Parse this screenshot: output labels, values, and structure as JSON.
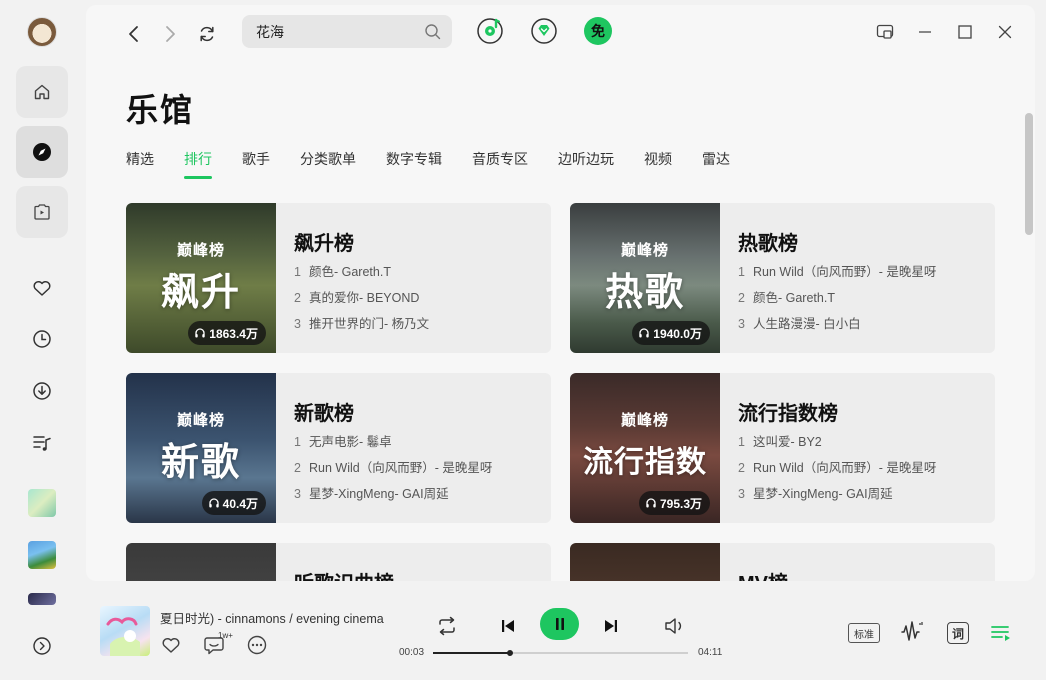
{
  "search": {
    "value": "花海"
  },
  "page": {
    "title": "乐馆"
  },
  "tabs": [
    {
      "label": "精选"
    },
    {
      "label": "排行"
    },
    {
      "label": "歌手"
    },
    {
      "label": "分类歌单"
    },
    {
      "label": "数字专辑"
    },
    {
      "label": "音质专区"
    },
    {
      "label": "边听边玩"
    },
    {
      "label": "视频"
    },
    {
      "label": "雷达"
    }
  ],
  "top_icons": {
    "vip_badge": "免"
  },
  "charts": [
    {
      "crown": "巅峰榜",
      "cover_word": "飙升",
      "plays": "1863.4万",
      "title": "飙升榜",
      "rows": [
        {
          "idx": "1",
          "text": "颜色- Gareth.T"
        },
        {
          "idx": "2",
          "text": "真的爱你- BEYOND"
        },
        {
          "idx": "3",
          "text": "推开世界的门- 杨乃文"
        }
      ]
    },
    {
      "crown": "巅峰榜",
      "cover_word": "热歌",
      "plays": "1940.0万",
      "title": "热歌榜",
      "rows": [
        {
          "idx": "1",
          "text": "Run Wild（向风而野）- 是晚星呀"
        },
        {
          "idx": "2",
          "text": "颜色- Gareth.T"
        },
        {
          "idx": "3",
          "text": "人生路漫漫- 白小白"
        }
      ]
    },
    {
      "crown": "巅峰榜",
      "cover_word": "新歌",
      "plays": "40.4万",
      "title": "新歌榜",
      "rows": [
        {
          "idx": "1",
          "text": "无声电影- 鬈卓"
        },
        {
          "idx": "2",
          "text": "Run Wild（向风而野）- 是晚星呀"
        },
        {
          "idx": "3",
          "text": "星梦-XingMeng- GAI周延"
        }
      ]
    },
    {
      "crown": "巅峰榜",
      "cover_word": "流行指数",
      "plays": "795.3万",
      "title": "流行指数榜",
      "rows": [
        {
          "idx": "1",
          "text": "这叫爱- BY2"
        },
        {
          "idx": "2",
          "text": "Run Wild（向风而野）- 是晚星呀"
        },
        {
          "idx": "3",
          "text": "星梦-XingMeng- GAI周延"
        }
      ]
    },
    {
      "title": "听歌识曲榜"
    },
    {
      "title": "MV榜"
    }
  ],
  "player": {
    "now_playing": "夏日时光)  -  cinnamons / evening cinema",
    "comment_count": "1w+",
    "elapsed": "00:03",
    "duration": "04:11",
    "progress": 0.3,
    "quality": "标准",
    "lyrics_label": "词"
  },
  "colors": {
    "accent": "#1ec660",
    "background": "#f2f2f2",
    "card": "#ededed"
  }
}
